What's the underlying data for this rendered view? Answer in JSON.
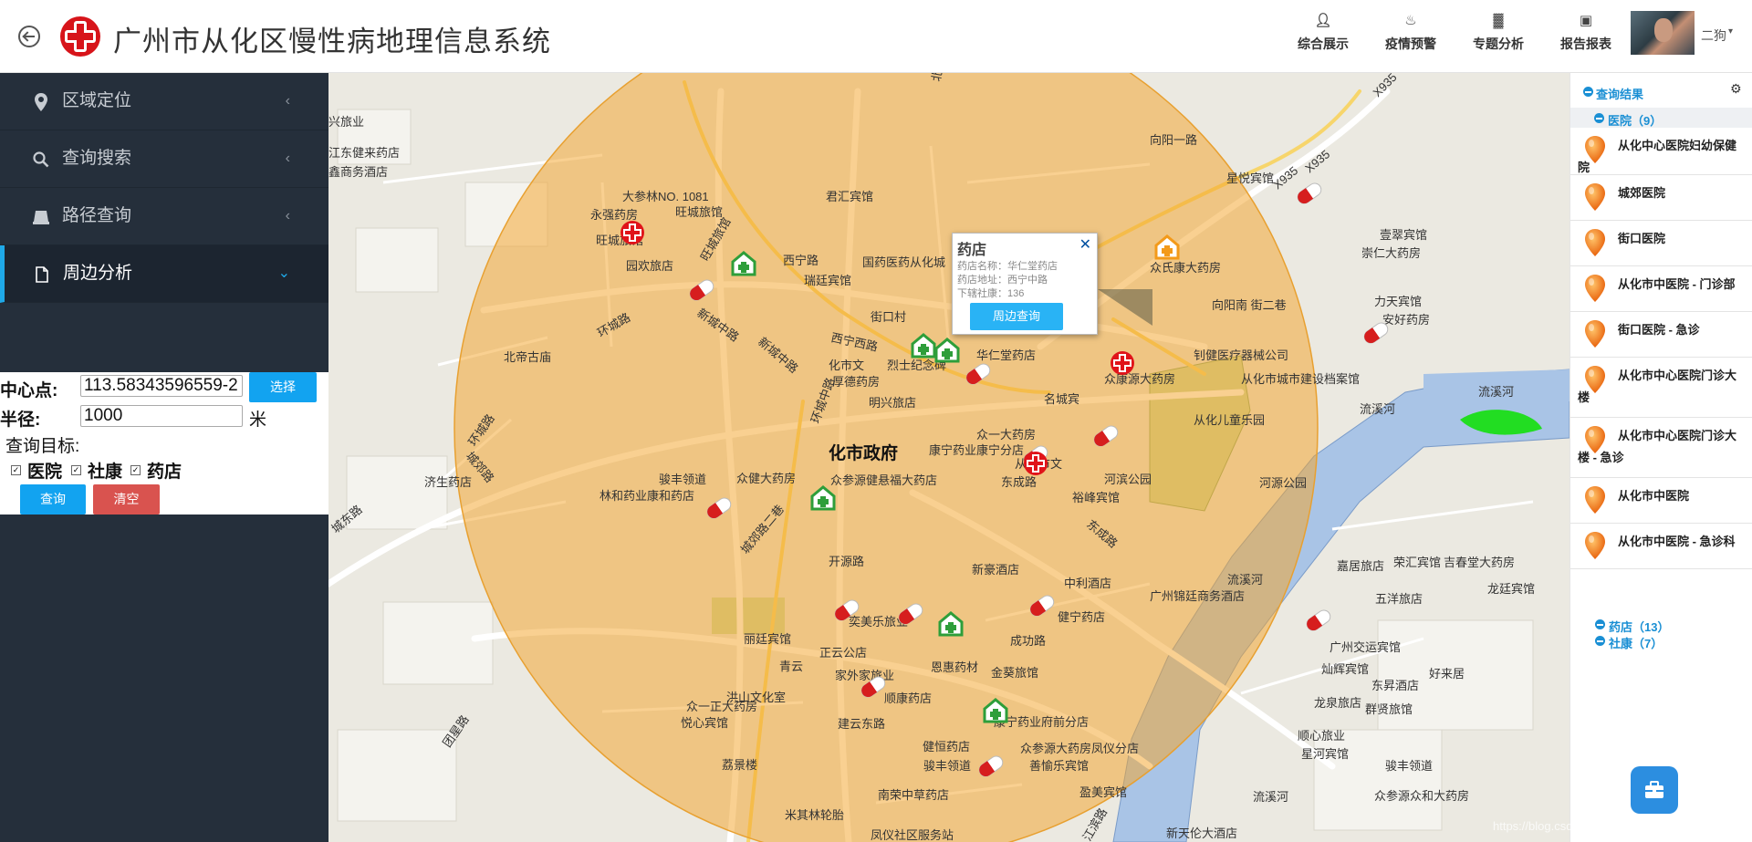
{
  "header": {
    "title": "广州市从化区慢性病地理信息系统",
    "nav": [
      {
        "label": "综合展示",
        "icon": "person-icon"
      },
      {
        "label": "疫情预警",
        "icon": "flame-icon"
      },
      {
        "label": "专题分析",
        "icon": "chart-icon"
      },
      {
        "label": "报告报表",
        "icon": "image-icon"
      }
    ],
    "user_name": "二狗",
    "user_caret": "▾"
  },
  "sidebar": {
    "menu": [
      {
        "label": "区域定位",
        "icon": "map-marker-icon",
        "arrow": "‹"
      },
      {
        "label": "查询搜索",
        "icon": "search-icon",
        "arrow": "‹"
      },
      {
        "label": "路径查询",
        "icon": "road-icon",
        "arrow": "‹"
      },
      {
        "label": "周边分析",
        "icon": "file-icon",
        "arrow": "⌄"
      }
    ],
    "form": {
      "center_label": "中心点:",
      "center_value": "113.58343596559-2",
      "select_button": "选择",
      "radius_label": "半径:",
      "radius_value": "1000",
      "radius_unit": "米",
      "target_label": "查询目标:",
      "targets": [
        {
          "label": "医院",
          "checked": true
        },
        {
          "label": "社康",
          "checked": true
        },
        {
          "label": "药店",
          "checked": true
        }
      ],
      "query_button": "查询",
      "clear_button": "清空"
    }
  },
  "map": {
    "popup": {
      "title": "药店",
      "close": "✕",
      "lines": [
        "药店名称：华仁堂药店",
        "药店地址：西宁中路",
        "下辖社康：136"
      ],
      "button": "周边查询"
    },
    "labels": [
      "兴旅业",
      "江东健来药店",
      "鑫商务酒店",
      "大参林NO. 1081",
      "永强药房",
      "旺城旅馆",
      "旺城旅馆",
      "园欢旅店",
      "环城路",
      "北帝古庙",
      "城郊路",
      "济生药店",
      "环城路",
      "城东路",
      "化市政府",
      "众健大药房",
      "林和药业康和药店",
      "骏丰领道",
      "众参源健悬福大药店",
      "君汇宾馆",
      "国药医药从化城",
      "瑞廷宾馆",
      "街口村",
      "西宁西路",
      "化市文",
      "烈士纪念碑",
      "明兴旅店",
      "厚德药房",
      "华仁堂药店",
      "向阳一路",
      "星悦宾馆",
      "众氏康大药房",
      "壹翠宾馆",
      "崇仁大药房",
      "力天宾馆",
      "安好药房",
      "向阳南 街二巷",
      "钊健医疗器械公司",
      "从化市城市建设档案馆",
      "众康源大药房",
      "名城宾",
      "从化儿童乐园",
      "众一大药房",
      "康宁药业康宁分店",
      "从化市文",
      "河滨公园",
      "东成路",
      "裕峰宾馆",
      "东成路",
      "河源公园",
      "流溪河",
      "流溪河",
      "流溪河",
      "开源路",
      "新豪酒店",
      "中利酒店",
      "广州锦廷商务酒店",
      "嘉居旅店",
      "荣汇宾馆",
      "吉春堂大药房",
      "龙廷宾馆",
      "五洋旅店",
      "健宁药店",
      "成功路",
      "奕美乐旅业",
      "恩惠药材",
      "金葵旅馆",
      "顺康药店",
      "家外家旅业",
      "建云东路",
      "康宁药业府前分店",
      "众参源大药房凤仪分店",
      "健恒药店",
      "善愉乐宾馆",
      "骏丰领道",
      "南荣中草药店",
      "米其林轮胎",
      "凤仪社区服务站",
      "盈美宾馆",
      "江滨路",
      "新天伦大酒店",
      "流溪河",
      "众参源众和大药房",
      "顺心旅业",
      "星河宾馆",
      "骏丰领道",
      "广州交运宾馆",
      "灿辉宾馆",
      "东昇酒店",
      "群贤旅馆",
      "龙泉旅店",
      "好来居",
      "荔景楼",
      "悦心宾馆",
      "洪山文化室",
      "众一正大药房",
      "正云公店",
      "青云",
      "丽廷宾馆",
      "X935",
      "X935",
      "X935",
      "北星路",
      "旺城旅馆",
      "西宁路",
      "新城中路",
      "新城中路",
      "环城中路",
      "团星路",
      "城郊路二巷"
    ]
  },
  "results": {
    "title": "查询结果",
    "groups": [
      {
        "label": "医院（9）"
      },
      {
        "label": "药店（13）"
      },
      {
        "label": "社康（7）"
      }
    ],
    "hospitals": [
      "从化中心医院妇幼保健院",
      "城郊医院",
      "街口医院",
      "从化市中医院 - 门诊部",
      "街口医院 - 急诊",
      "从化市中心医院门诊大楼",
      "从化市中心医院门诊大楼 - 急诊",
      "从化市中医院",
      "从化市中医院 - 急诊科"
    ]
  },
  "watermark": "https://blog.csdn.net/weixin_44538423"
}
